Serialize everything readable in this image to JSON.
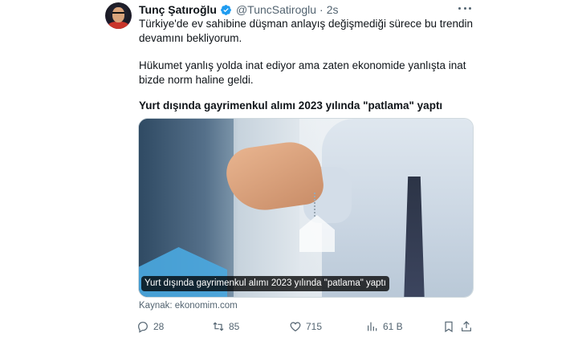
{
  "tweet": {
    "author": {
      "name": "Tunç Şatıroğlu",
      "handle": "@TuncSatiroglu",
      "separator": "·",
      "time": "2s",
      "verified": true
    },
    "paragraphs": [
      "Türkiye'de ev sahibine düşman anlayış değişmediği sürece bu trendin devamını bekliyorum.",
      "Hükumet yanlış yolda inat ediyor ama zaten ekonomide yanlışta inat bizde norm haline geldi."
    ],
    "headline": "Yurt dışında gayrimenkul alımı 2023 yılında \"patlama\" yaptı",
    "media": {
      "caption": "Yurt dışında gayrimenkul alımı 2023 yılında \"patlama\" yaptı",
      "source": "Kaynak: ekonomim.com"
    },
    "actions": {
      "replies": "28",
      "retweets": "85",
      "likes": "715",
      "views": "61 B"
    }
  },
  "colors": {
    "text": "#0f1419",
    "secondary": "#536471",
    "verified": "#1d9bf0",
    "border": "#cfd9de"
  },
  "icons": [
    "verified-badge-icon",
    "more-icon",
    "reply-icon",
    "retweet-icon",
    "like-icon",
    "views-icon",
    "bookmark-icon",
    "share-icon"
  ]
}
